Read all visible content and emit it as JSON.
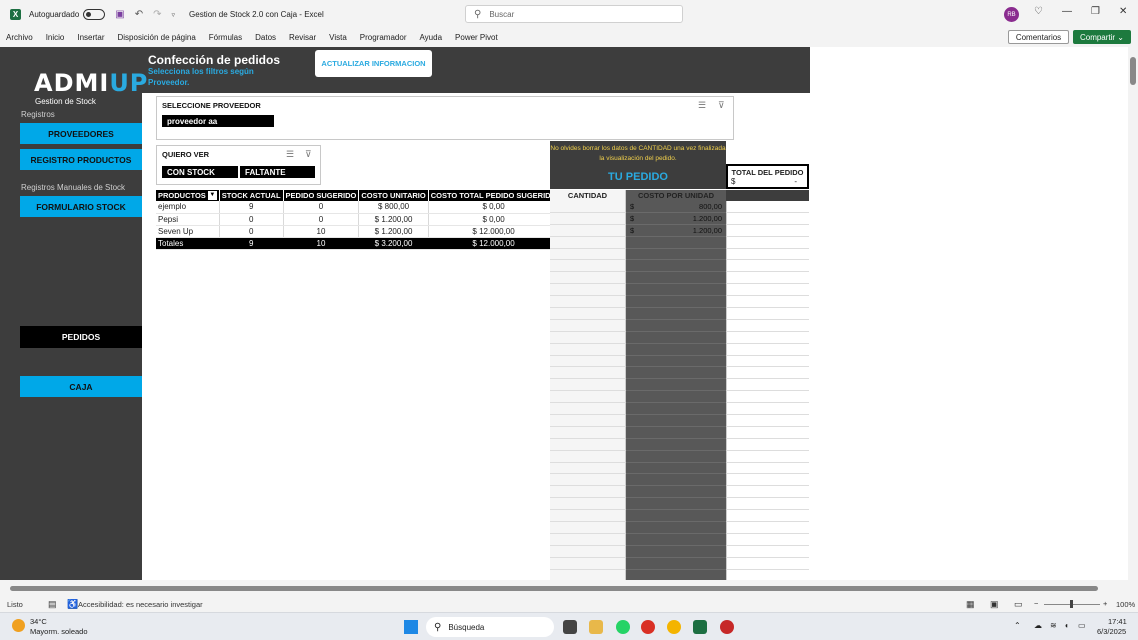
{
  "window": {
    "autosave_label": "Autoguardado",
    "title": "Gestion de Stock 2.0 con Caja  -  Excel",
    "search_placeholder": "Buscar",
    "avatar_initials": "RB"
  },
  "menu": [
    "Archivo",
    "Inicio",
    "Insertar",
    "Disposición de página",
    "Fórmulas",
    "Datos",
    "Revisar",
    "Vista",
    "Programador",
    "Ayuda",
    "Power Pivot"
  ],
  "ribbon_right": {
    "comments": "Comentarios",
    "share": "Compartir ⌄"
  },
  "sidebar": {
    "logo_admi": "ADMI",
    "logo_up": "UP",
    "logo_sub": "Gestion de Stock",
    "registros_label": "Registros",
    "btn_proveedores": "PROVEEDORES",
    "btn_registro_productos": "REGISTRO PRODUCTOS",
    "manuales_label": "Registros Manuales de Stock",
    "btn_formulario": "FORMULARIO STOCK",
    "btn_pedidos": "PEDIDOS",
    "btn_caja": "CAJA"
  },
  "header": {
    "title": "Confección de pedidos",
    "subtitle": "Selecciona los filtros según Proveedor.",
    "update_button": "ACTUALIZAR INFORMACION"
  },
  "slicer_proveedor": {
    "title": "SELECCIONE PROVEEDOR",
    "selected": "proveedor aa"
  },
  "slicer_quiero_ver": {
    "title": "QUIERO VER",
    "options": [
      "CON STOCK",
      "FALTANTE"
    ]
  },
  "pivot": {
    "headers": [
      "PRODUCTOS",
      "STOCK ACTUAL",
      "PEDIDO SUGERIDO",
      "COSTO UNITARIO",
      "COSTO TOTAL PEDIDO SUGERIDO"
    ],
    "rows": [
      [
        "ejemplo",
        "9",
        "0",
        "$ 800,00",
        "$ 0,00"
      ],
      [
        "Pepsi",
        "0",
        "0",
        "$ 1.200,00",
        "$ 0,00"
      ],
      [
        "Seven Up",
        "0",
        "10",
        "$ 1.200,00",
        "$ 12.000,00"
      ]
    ],
    "totals": [
      "Totales",
      "9",
      "10",
      "$ 3.200,00",
      "$ 12.000,00"
    ]
  },
  "order": {
    "reminder": "No olvides borrar los datos de CANTIDAD una vez finalizada la visualización del pedido.",
    "title": "TU PEDIDO",
    "total_label": "TOTAL DEL PEDIDO",
    "total_currency": "$",
    "total_value": "-",
    "col_cantidad": "CANTIDAD",
    "col_costo": "COSTO POR UNIDAD",
    "costs": [
      {
        "currency": "$",
        "value": "800,00"
      },
      {
        "currency": "$",
        "value": "1.200,00"
      },
      {
        "currency": "$",
        "value": "1.200,00"
      }
    ]
  },
  "status": {
    "ready": "Listo",
    "accessibility": "Accesibilidad: es necesario investigar",
    "zoom": "100%"
  },
  "taskbar": {
    "weather_temp": "34°C",
    "weather_desc": "Mayorm. soleado",
    "search": "Búsqueda",
    "time": "17:41",
    "date": "6/3/2025"
  }
}
